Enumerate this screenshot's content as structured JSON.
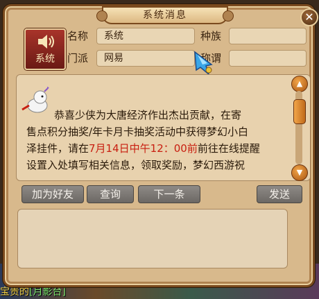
{
  "window": {
    "title": "系统消息",
    "close_label": "✕"
  },
  "sender": {
    "avatar_label": "系统",
    "fields": {
      "name_label": "名称",
      "name_value": "系统",
      "school_label": "门派",
      "school_value": "网易",
      "race_label": "种族",
      "race_value": "",
      "title_label": "称谓",
      "title_value": ""
    }
  },
  "message": {
    "line1": "恭喜少侠为大唐经济作出杰出贡献，在寄",
    "line2": "售点积分抽奖/年卡月卡抽奖活动中获得梦幻小白",
    "line3_a": "泽挂件，请在",
    "line3_red": "7月14日中午12：00前",
    "line3_b": "前往在线提醒",
    "line4": "设置入处填写相关信息，领取奖励，梦幻西游祝"
  },
  "buttons": {
    "add_friend": "加为好友",
    "query": "查询",
    "next": "下一条",
    "send": "发送"
  },
  "scene": {
    "text_a": "宝贵的",
    "text_b": "[月影台]"
  },
  "colors": {
    "accent_red": "#c81e10",
    "button_gray": "#7c7874"
  }
}
